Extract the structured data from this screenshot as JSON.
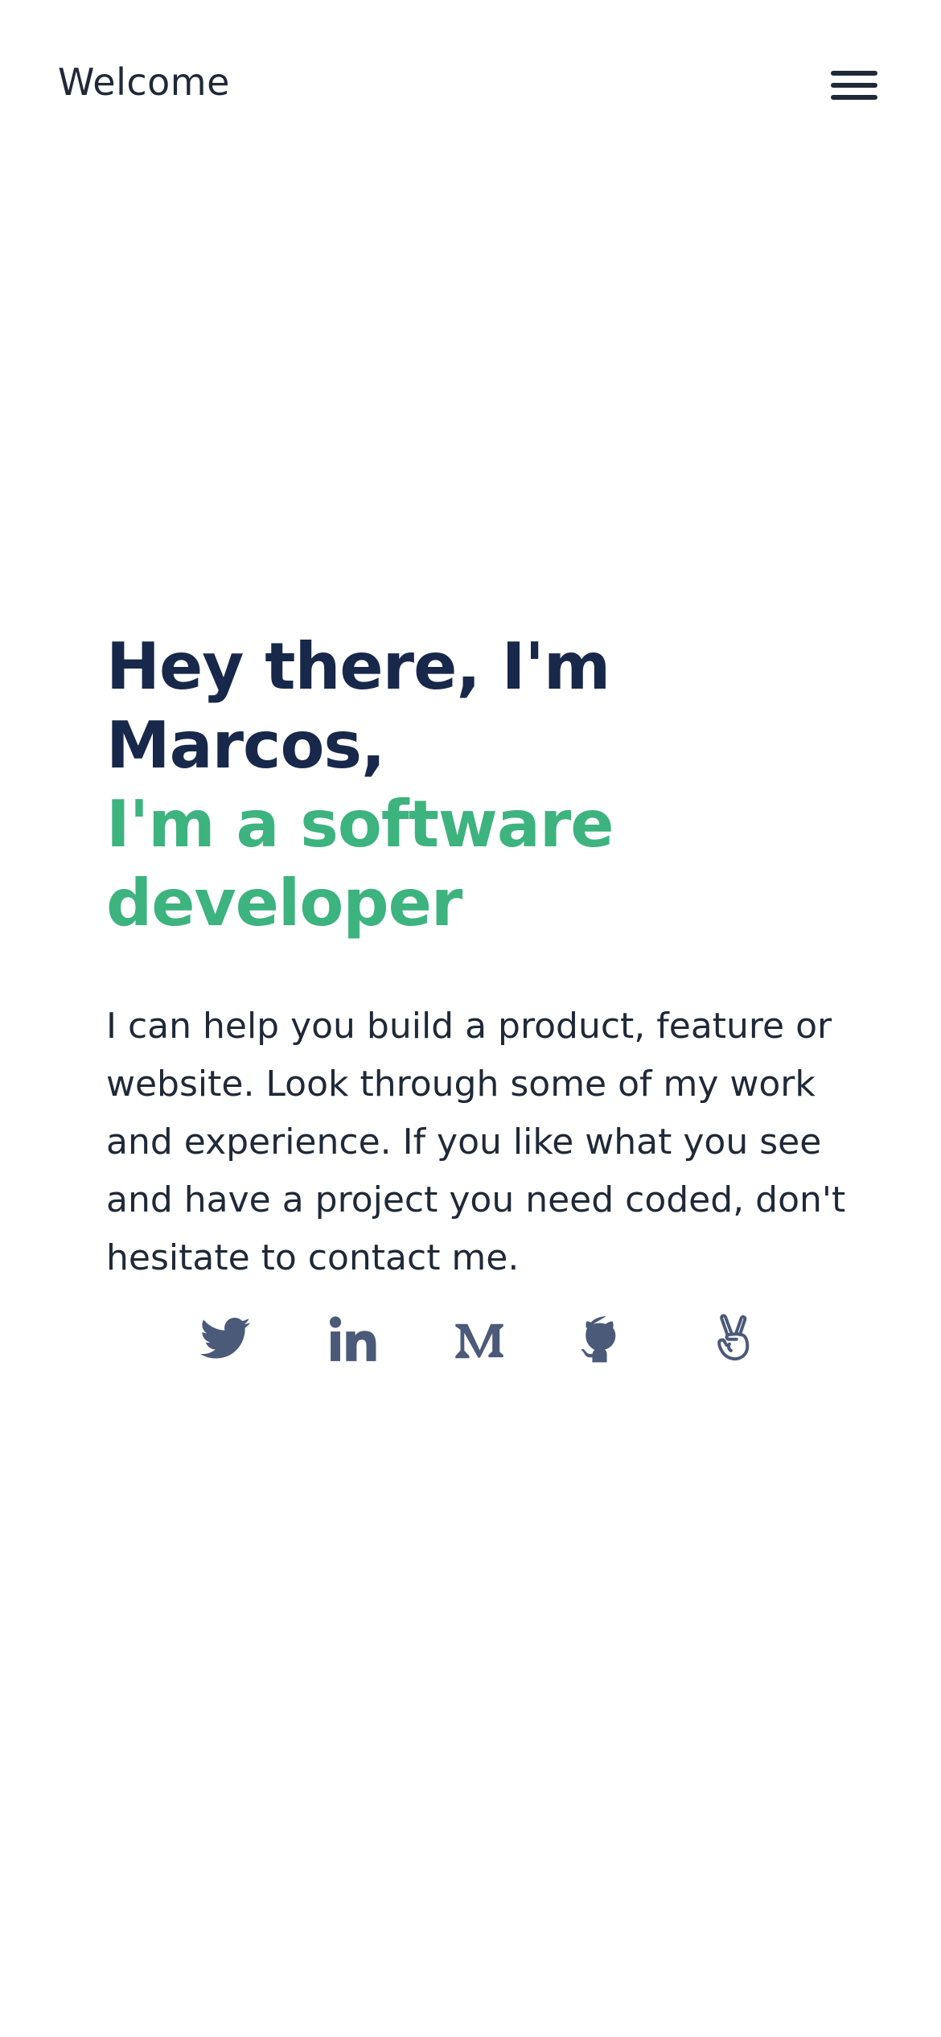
{
  "header": {
    "brand": "Welcome",
    "menu_icon": "hamburger-menu-icon"
  },
  "hero": {
    "headline_line1": "Hey there, I'm Marcos,",
    "headline_line2": "I'm a software developer",
    "intro": "I can help you build a product, feature or website. Look through some of my work and experience. If you like what you see and have a project you need coded, don't hesitate to contact me."
  },
  "socials": [
    {
      "icon": "twitter-icon"
    },
    {
      "icon": "linkedin-icon"
    },
    {
      "icon": "medium-icon"
    },
    {
      "icon": "github-icon"
    },
    {
      "icon": "angellist-icon"
    }
  ],
  "colors": {
    "heading": "#18284a",
    "accent": "#3db37f",
    "body_text": "#1f2937",
    "icons": "#4b5a78",
    "background": "#ffffff"
  }
}
